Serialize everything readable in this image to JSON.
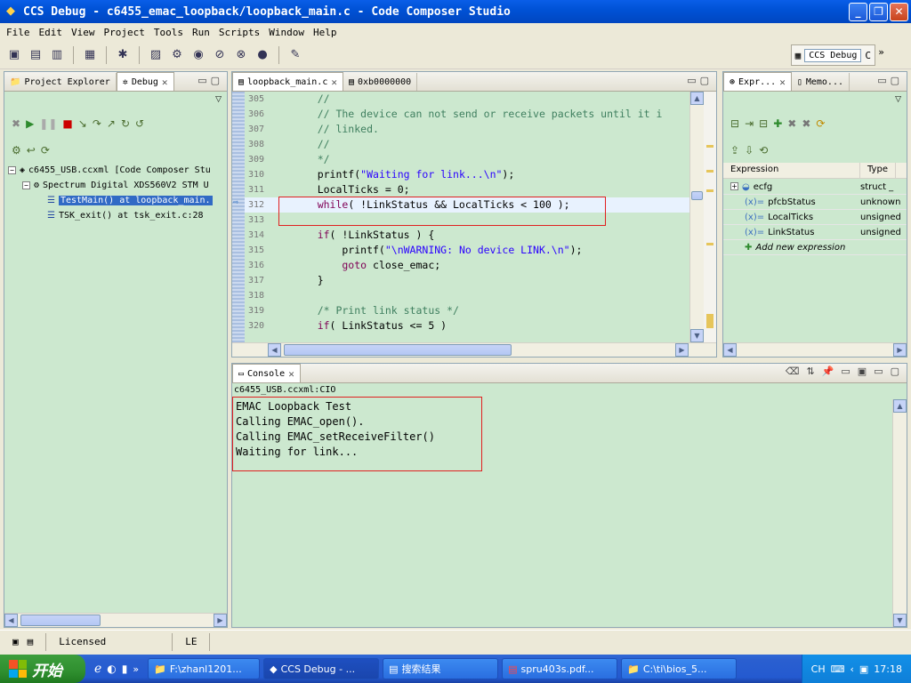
{
  "window": {
    "title": "CCS Debug - c6455_emac_loopback/loopback_main.c - Code Composer Studio"
  },
  "menu": [
    "File",
    "Edit",
    "View",
    "Project",
    "Tools",
    "Run",
    "Scripts",
    "Window",
    "Help"
  ],
  "perspective": {
    "active": "CCS Debug",
    "other": "C"
  },
  "left_panel": {
    "tabs": [
      "Project Explorer",
      "Debug"
    ],
    "tree": [
      {
        "label": "c6455_USB.ccxml [Code Composer Stu"
      },
      {
        "label": "Spectrum Digital XDS560V2 STM U"
      },
      {
        "label": "TestMain() at loopback_main."
      },
      {
        "label": "TSK_exit() at tsk_exit.c:28"
      }
    ]
  },
  "editor": {
    "tabs": [
      "loopback_main.c",
      "0xb0000000"
    ],
    "lines": [
      {
        "num": "305",
        "parts": [
          {
            "t": "    //",
            "c": "cm"
          }
        ]
      },
      {
        "num": "306",
        "parts": [
          {
            "t": "    // The device can not send or receive packets until it i",
            "c": "cm"
          }
        ]
      },
      {
        "num": "307",
        "parts": [
          {
            "t": "    // linked.",
            "c": "cm"
          }
        ]
      },
      {
        "num": "308",
        "parts": [
          {
            "t": "    //",
            "c": "cm"
          }
        ]
      },
      {
        "num": "309",
        "parts": [
          {
            "t": "    */",
            "c": "cm"
          }
        ]
      },
      {
        "num": "310",
        "parts": [
          {
            "t": "    printf(",
            "c": ""
          },
          {
            "t": "\"Waiting for link...\\n\"",
            "c": "str"
          },
          {
            "t": ");",
            "c": ""
          }
        ]
      },
      {
        "num": "311",
        "parts": [
          {
            "t": "    LocalTicks = 0;",
            "c": ""
          }
        ]
      },
      {
        "num": "312",
        "parts": [
          {
            "t": "    while",
            "c": "kw"
          },
          {
            "t": "( !LinkStatus && LocalTicks < 100 );",
            "c": ""
          }
        ]
      },
      {
        "num": "313",
        "parts": [
          {
            "t": "",
            "c": ""
          }
        ]
      },
      {
        "num": "314",
        "parts": [
          {
            "t": "    if",
            "c": "kw"
          },
          {
            "t": "( !LinkStatus ) {",
            "c": ""
          }
        ]
      },
      {
        "num": "315",
        "parts": [
          {
            "t": "        printf(",
            "c": ""
          },
          {
            "t": "\"\\nWARNING: No device LINK.\\n\"",
            "c": "str"
          },
          {
            "t": ");",
            "c": ""
          }
        ]
      },
      {
        "num": "316",
        "parts": [
          {
            "t": "        goto",
            "c": "kw"
          },
          {
            "t": " close_emac;",
            "c": ""
          }
        ]
      },
      {
        "num": "317",
        "parts": [
          {
            "t": "    }",
            "c": ""
          }
        ]
      },
      {
        "num": "318",
        "parts": [
          {
            "t": "",
            "c": ""
          }
        ]
      },
      {
        "num": "319",
        "parts": [
          {
            "t": "    /* Print link status */",
            "c": "cm"
          }
        ]
      },
      {
        "num": "320",
        "parts": [
          {
            "t": "    if",
            "c": "kw"
          },
          {
            "t": "( LinkStatus <= 5 )",
            "c": ""
          }
        ]
      }
    ]
  },
  "expressions": {
    "tabs": [
      "Expr...",
      "Memo..."
    ],
    "headers": [
      "Expression",
      "Type"
    ],
    "rows": [
      {
        "name": "ecfg",
        "type": "struct _"
      },
      {
        "name": "pfcbStatus",
        "type": "unknown"
      },
      {
        "name": "LocalTicks",
        "type": "unsigned"
      },
      {
        "name": "LinkStatus",
        "type": "unsigned"
      }
    ],
    "add_label": "Add new expression"
  },
  "console": {
    "tab": "Console",
    "source": "c6455_USB.ccxml:CIO",
    "lines": [
      "EMAC Loopback Test",
      "Calling EMAC_open().",
      "Calling EMAC_setReceiveFilter()",
      "Waiting for link..."
    ]
  },
  "status": {
    "license": "Licensed",
    "mode": "LE"
  },
  "taskbar": {
    "start": "开始",
    "tasks": [
      "F:\\zhanl1201...",
      "CCS Debug - ...",
      "搜索结果",
      "spru403s.pdf...",
      "C:\\ti\\bios_5..."
    ],
    "lang": "CH",
    "time": "17:18"
  }
}
